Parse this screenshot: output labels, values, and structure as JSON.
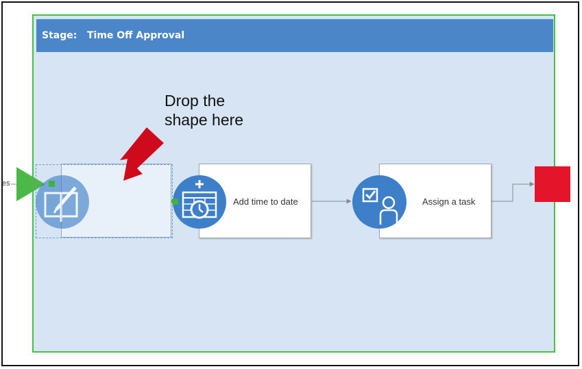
{
  "stage": {
    "prefix": "Stage:",
    "name": "Time Off Approval",
    "border_color": "#44c043",
    "header_color": "#4a86c8",
    "fill_color": "#d6e4f3"
  },
  "callout": {
    "line1": "Drop the",
    "line2": "shape here",
    "arrow_color": "#cf0a1c"
  },
  "left_edge_text": "es",
  "steps": [
    {
      "label": "Add time to date",
      "icon": "calendar-clock-icon"
    },
    {
      "label": "Assign a task",
      "icon": "task-assign-icon"
    }
  ],
  "dragged_shape": {
    "icon": "form-edit-icon"
  },
  "start_color": "#4cb848",
  "end_color": "#e4142a"
}
